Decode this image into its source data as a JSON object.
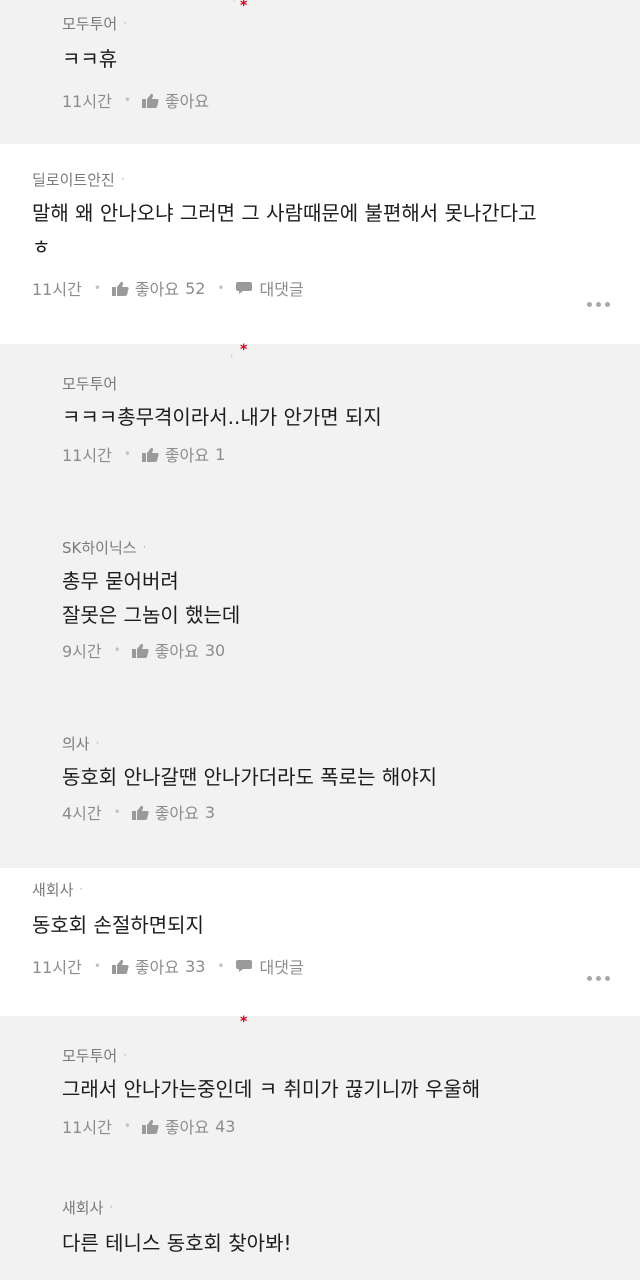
{
  "comments": [
    {
      "author": "모두투어",
      "body": "ㅋㅋ휴",
      "time": "11시간",
      "like_label": "좋아요",
      "like_count": ""
    },
    {
      "author": "딜로이트안진",
      "body": "말해 왜 안나오냐 그러면 그 사람때문에 불편해서 못나간다고\nㅎ",
      "time": "11시간",
      "like_label": "좋아요",
      "like_count": "52",
      "reply_label": "대댓글"
    },
    {
      "author": "모두투어",
      "body": "ㅋㅋㅋ총무격이라서..내가 안가면 되지",
      "time": "11시간",
      "like_label": "좋아요",
      "like_count": "1"
    },
    {
      "author": "SK하이닉스",
      "body": "총무 묻어버려\n잘못은 그놈이 했는데",
      "time": "9시간",
      "like_label": "좋아요",
      "like_count": "30"
    },
    {
      "author": "의사",
      "body": "동호회 안나갈땐 안나가더라도 폭로는 해야지",
      "time": "4시간",
      "like_label": "좋아요",
      "like_count": "3"
    },
    {
      "author": "새회사",
      "body": "동호회 손절하면되지",
      "time": "11시간",
      "like_label": "좋아요",
      "like_count": "33",
      "reply_label": "대댓글"
    },
    {
      "author": "모두투어",
      "body": "그래서 안나가는중인데 ㅋ 취미가 끊기니까 우울해",
      "time": "11시간",
      "like_label": "좋아요",
      "like_count": "43"
    },
    {
      "author": "새회사",
      "body": "다른 테니스 동호회 찾아봐!"
    }
  ],
  "icons": {
    "like": "thumbs-up-icon",
    "reply": "speech-bubble-icon",
    "more": "more-dots-icon"
  },
  "colors": {
    "author_mark": "#d0021b",
    "reply_bg": "#f2f2f2",
    "top_bg": "#ffffff"
  }
}
